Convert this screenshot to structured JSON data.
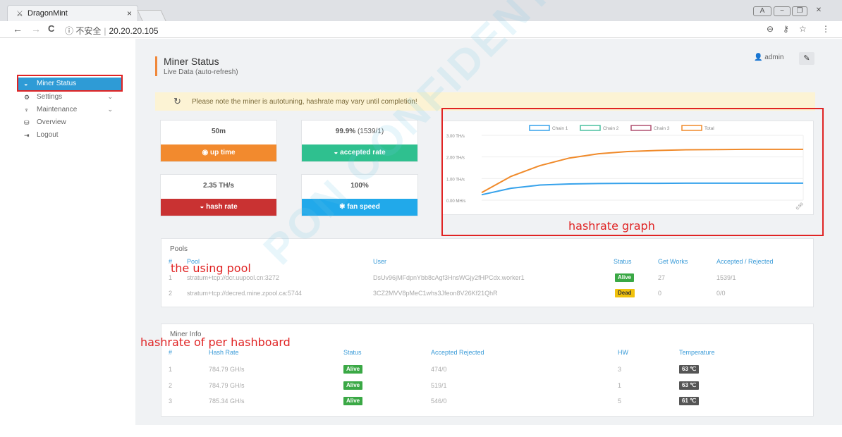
{
  "browser": {
    "tab_title": "DragonMint",
    "tab_close": "×",
    "security_label": "不安全",
    "url": "20.20.20.105",
    "back": "←",
    "forward": "→",
    "reload": "C",
    "info": "ⓘ"
  },
  "sidebar": {
    "items": [
      {
        "label": "Miner Status",
        "icon": "dashboard-icon",
        "active": true
      },
      {
        "label": "Settings",
        "icon": "gears-icon"
      },
      {
        "label": "Maintenance",
        "icon": "plug-icon"
      },
      {
        "label": "Overview",
        "icon": "database-icon"
      },
      {
        "label": "Logout",
        "icon": "sign-out-icon"
      }
    ]
  },
  "header": {
    "title": "Miner Status",
    "subtitle": "Live Data (auto-refresh)",
    "user": "admin"
  },
  "notice": "Please note the miner is autotuning, hashrate may vary until completion!",
  "stats": {
    "uptime": {
      "value": "50m",
      "label": "up time"
    },
    "accepted": {
      "value": "99.9%",
      "detail": "(1539/1)",
      "label": "accepted rate"
    },
    "hashrate": {
      "value": "2.35 TH/s",
      "label": "hash rate"
    },
    "fan": {
      "value": "100%",
      "label": "fan speed"
    }
  },
  "chart_data": {
    "type": "line",
    "series": [
      {
        "name": "Chain 1",
        "color": "#36a2eb"
      },
      {
        "name": "Chain 2",
        "color": "#4bc0a0"
      },
      {
        "name": "Chain 3",
        "color": "#b05070"
      },
      {
        "name": "Total",
        "color": "#f08a2a",
        "y": [
          0.35,
          1.1,
          1.6,
          1.95,
          2.15,
          2.25,
          2.3,
          2.33,
          2.34,
          2.35,
          2.35,
          2.35
        ]
      }
    ],
    "blue_line": {
      "y": [
        0.25,
        0.55,
        0.7,
        0.75,
        0.77,
        0.78,
        0.78,
        0.785,
        0.785,
        0.785,
        0.785,
        0.785
      ]
    },
    "yticks": [
      "3.00 TH/s",
      "2.00 TH/s",
      "1.00 TH/s",
      "0.00 MH/s"
    ],
    "ylim": [
      0,
      3
    ],
    "xtick_last": "0:50"
  },
  "pools": {
    "title": "Pools",
    "headers": {
      "num": "#",
      "pool": "Pool",
      "user": "User",
      "status": "Status",
      "getworks": "Get Works",
      "accepted": "Accepted / Rejected"
    },
    "rows": [
      {
        "num": "1",
        "pool": "stratum+tcp://dcr.uupool.cn:3272",
        "user": "DsUv96jMFdpnYbb8cAgf3HnsWGjy2fHPCdx.worker1",
        "status": "Alive",
        "getworks": "27",
        "accepted": "1539/1"
      },
      {
        "num": "2",
        "pool": "stratum+tcp://decred.mine.zpool.ca:5744",
        "user": "3CZ2MVV8pMeC1whs3Jfeon8V26Kf21QhR",
        "status": "Dead",
        "getworks": "0",
        "accepted": "0/0"
      }
    ]
  },
  "miner_info": {
    "title": "Miner Info",
    "headers": {
      "num": "#",
      "hashrate": "Hash Rate",
      "status": "Status",
      "accepted": "Accepted Rejected",
      "hw": "HW",
      "temp": "Temperature"
    },
    "rows": [
      {
        "num": "1",
        "hashrate": "784.79 GH/s",
        "status": "Alive",
        "accepted": "474/0",
        "hw": "3",
        "temp": "63 ℃"
      },
      {
        "num": "2",
        "hashrate": "784.79 GH/s",
        "status": "Alive",
        "accepted": "519/1",
        "hw": "1",
        "temp": "63 ℃"
      },
      {
        "num": "3",
        "hashrate": "785.34 GH/s",
        "status": "Alive",
        "accepted": "546/0",
        "hw": "5",
        "temp": "61 ℃"
      }
    ]
  },
  "annotations": {
    "graph": "hashrate graph",
    "pool": "the using pool",
    "board": "hashrate of per hashboard"
  },
  "watermark": "PON CONFIDENTIAL"
}
